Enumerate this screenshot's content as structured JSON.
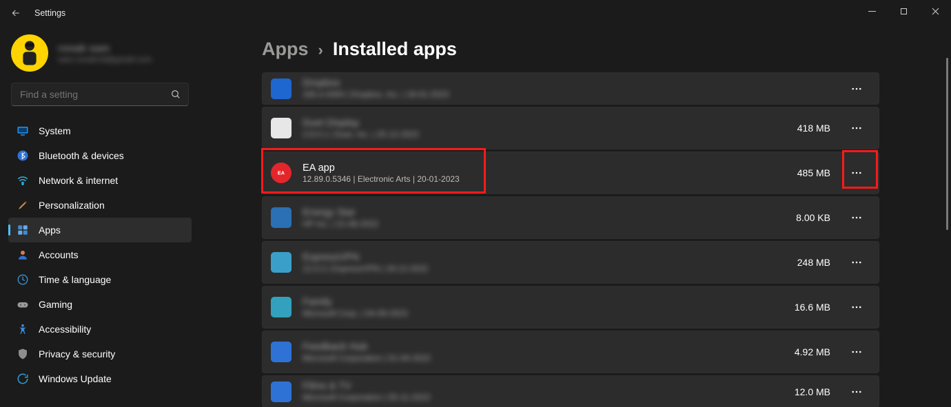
{
  "window": {
    "title": "Settings"
  },
  "profile": {
    "name": "ronak sam",
    "mail": "sam.ronak16@gmail.com"
  },
  "search": {
    "placeholder": "Find a setting"
  },
  "sidebar": {
    "items": [
      {
        "label": "System"
      },
      {
        "label": "Bluetooth & devices"
      },
      {
        "label": "Network & internet"
      },
      {
        "label": "Personalization"
      },
      {
        "label": "Apps"
      },
      {
        "label": "Accounts"
      },
      {
        "label": "Time & language"
      },
      {
        "label": "Gaming"
      },
      {
        "label": "Accessibility"
      },
      {
        "label": "Privacy & security"
      },
      {
        "label": "Windows Update"
      }
    ]
  },
  "breadcrumb": {
    "parent": "Apps",
    "current": "Installed apps"
  },
  "apps": [
    {
      "name": "Dropbox",
      "meta": "165.4.4300  |  Dropbox, Inc.  |  18-01-2023",
      "size": "",
      "blurred": true,
      "icon": "#1e66d0",
      "short": true
    },
    {
      "name": "Duet Display",
      "meta": "2.6.0.1  |  Duet, Inc.  |  25-12-2022",
      "size": "418 MB",
      "blurred": true,
      "icon": "#e7e7e7"
    },
    {
      "name": "EA app",
      "meta": "12.89.0.5346   |   Electronic Arts   |   20-01-2023",
      "size": "485 MB",
      "blurred": false,
      "icon": "#e3262b"
    },
    {
      "name": "Energy Star",
      "meta": "HP Inc.  |  21-08-2022",
      "size": "8.00 KB",
      "blurred": true,
      "icon": "#2b6fb5"
    },
    {
      "name": "ExpressVPN",
      "meta": "12.0.2  |  ExpressVPN  |  19-12-2022",
      "size": "248 MB",
      "blurred": true,
      "icon": "#3aa0c9"
    },
    {
      "name": "Family",
      "meta": "Microsoft Corp.  |  04-09-2023",
      "size": "16.6 MB",
      "blurred": true,
      "icon": "#33a1bd"
    },
    {
      "name": "Feedback Hub",
      "meta": "Microsoft Corporation  |  01-04-2022",
      "size": "4.92 MB",
      "blurred": true,
      "icon": "#2f72d6"
    },
    {
      "name": "Films & TV",
      "meta": "Microsoft Corporation  |  05-11-2023",
      "size": "12.0 MB",
      "blurred": true,
      "icon": "#2f72d6",
      "short": true
    }
  ]
}
